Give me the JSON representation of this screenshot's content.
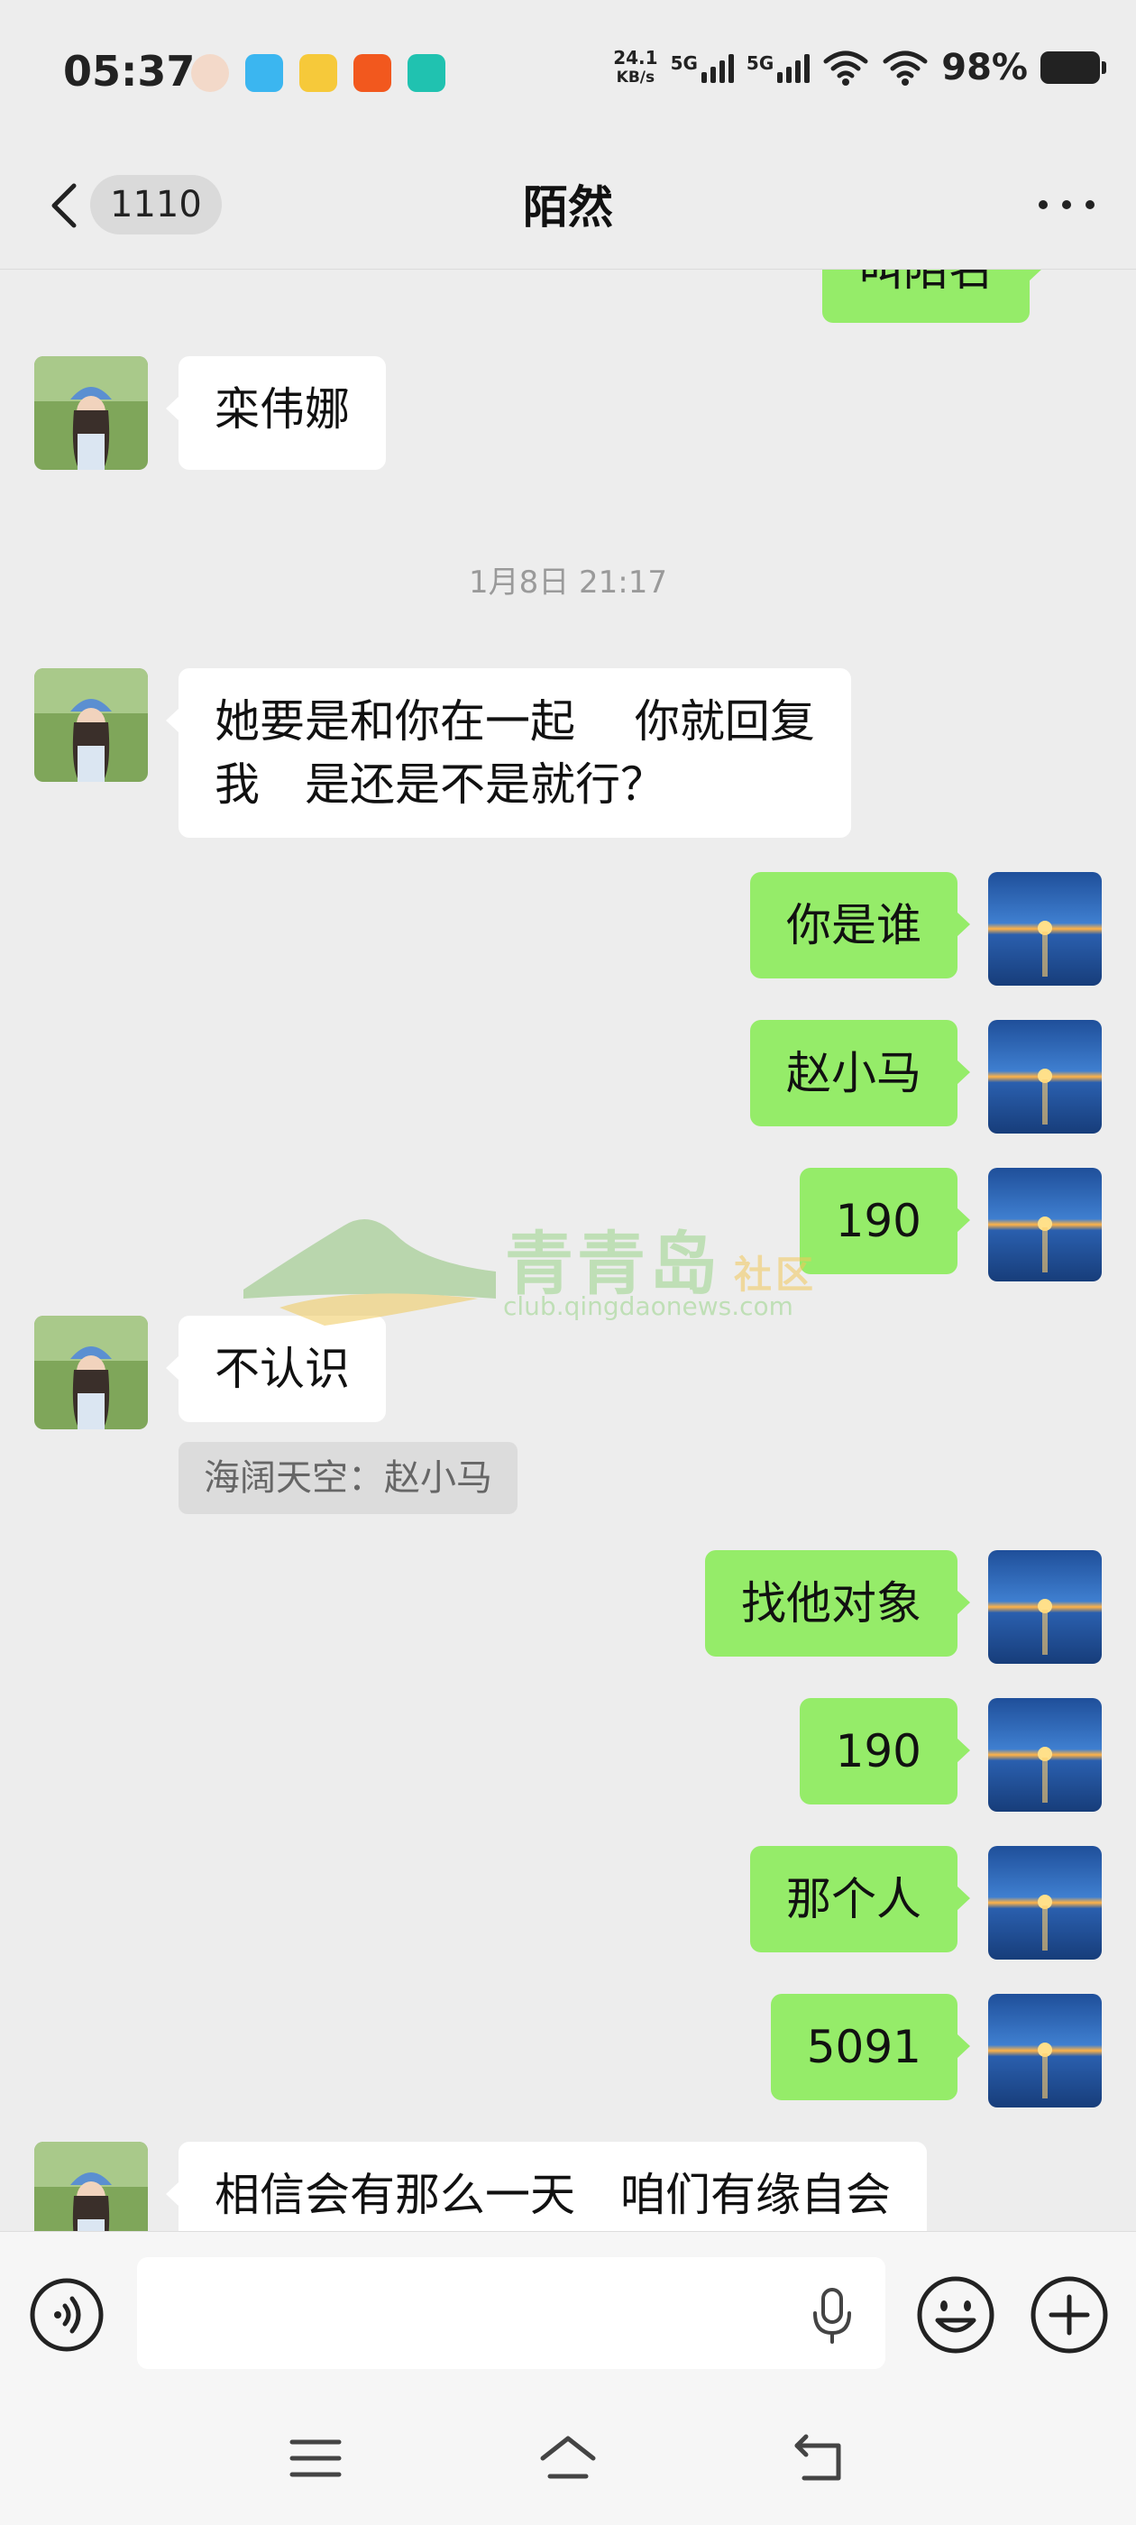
{
  "status_bar": {
    "time": "05:37",
    "net_speed_value": "24.1",
    "net_speed_unit": "KB/s",
    "sim1": "5G",
    "sim2": "5G",
    "battery": "98%"
  },
  "header": {
    "unread_count": "1110",
    "title": "陌然"
  },
  "chat": {
    "partial_top_text": "叫陌名",
    "msg_in_1": "栾伟娜",
    "timestamp_1": "1月8日 21:17",
    "msg_in_2_line1": "她要是和你在一起　  你就回复",
    "msg_in_2_line2": "我　是还是不是就行？",
    "msg_out_1": "你是谁",
    "msg_out_2": "赵小马",
    "msg_out_3": "190",
    "msg_in_3": "不认识",
    "quote_in_3": "海阔天空：赵小马",
    "msg_out_4": "找他对象",
    "msg_out_5": "190",
    "msg_out_6": "那个人",
    "msg_out_7": "5091",
    "msg_in_4": "相信会有那么一天　咱们有缘自会"
  },
  "watermark": {
    "brand": "青青岛",
    "tag": "社区",
    "url": "club.qingdaonews.com"
  },
  "input": {
    "placeholder": ""
  },
  "colors": {
    "background": "#ededed",
    "outgoing_bubble": "#95ec69",
    "incoming_bubble": "#ffffff"
  },
  "icons": [
    "back-icon",
    "more-icon",
    "voice-mode-icon",
    "microphone-icon",
    "emoji-icon",
    "plus-icon",
    "menu-icon",
    "home-icon",
    "return-icon"
  ]
}
